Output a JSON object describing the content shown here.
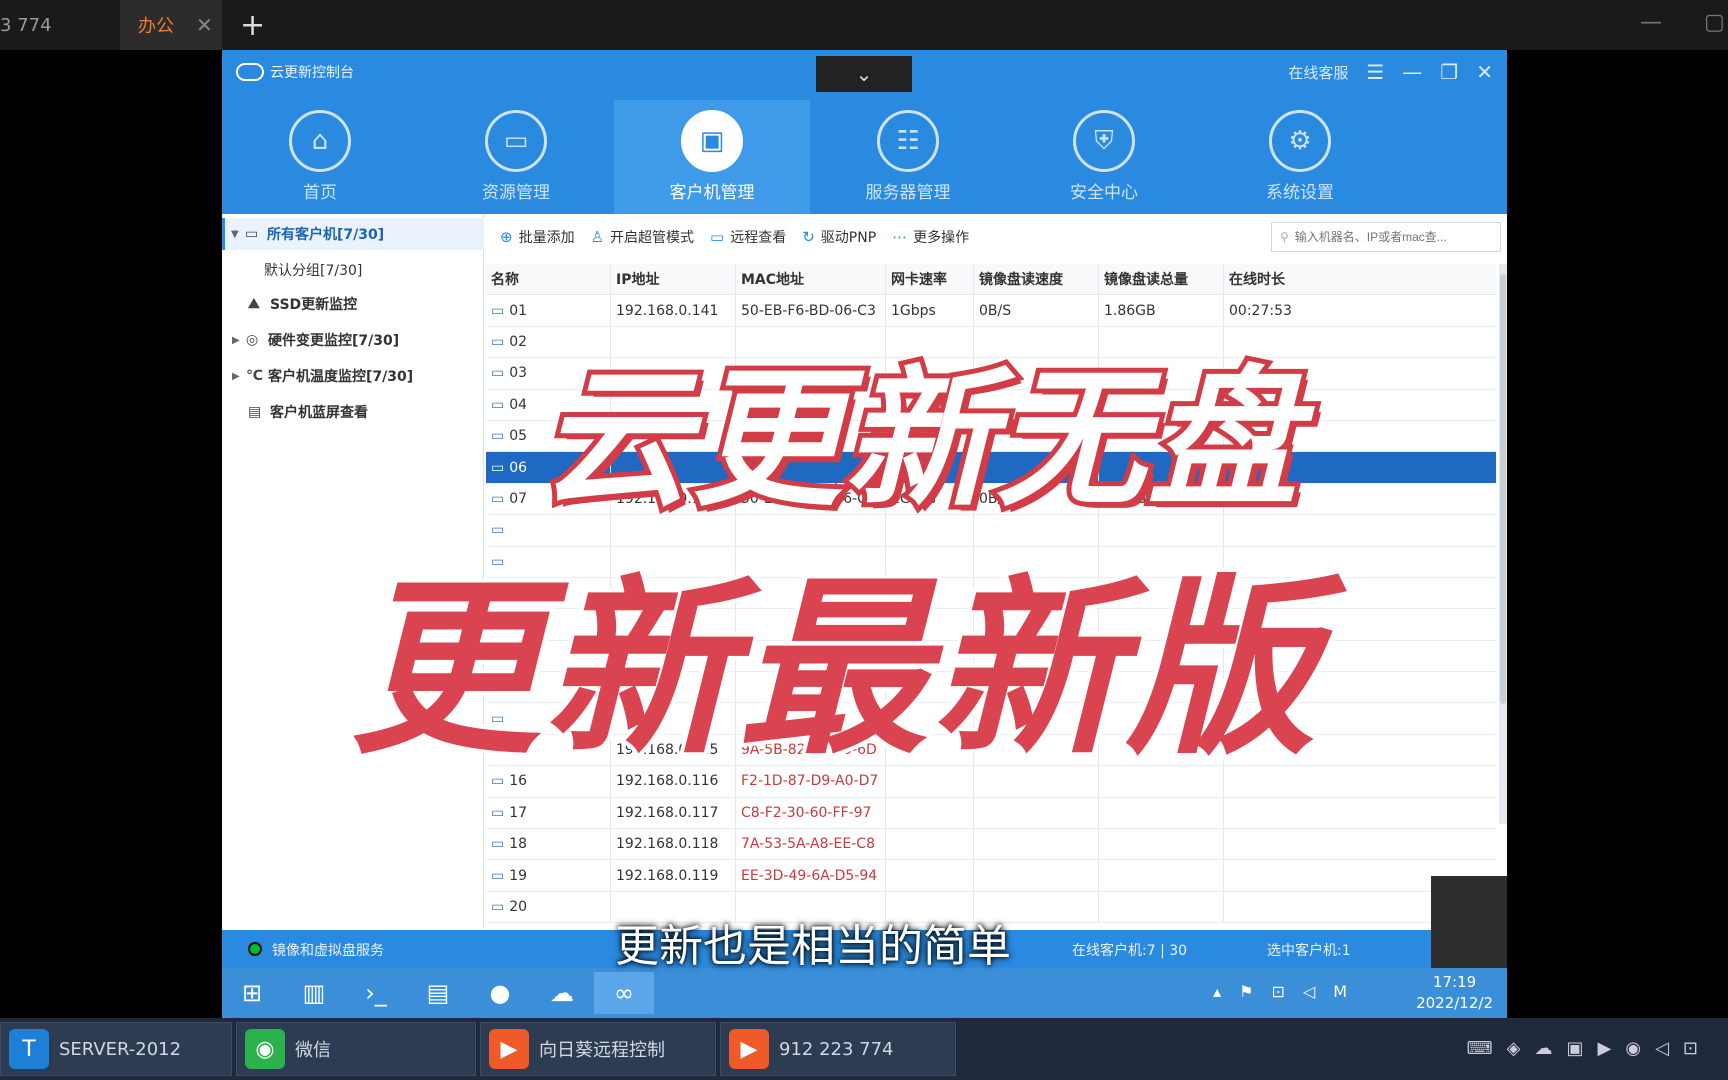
{
  "outer_tabs": {
    "tab1_label": "3 774",
    "tab2_label": "办公",
    "close_glyph": "✕",
    "new_tab_glyph": "+"
  },
  "app": {
    "title": "云更新控制台",
    "dropdown_glyph": "⌄",
    "online_service": "在线客服",
    "nav": [
      {
        "label": "首页",
        "icon": "home-icon"
      },
      {
        "label": "资源管理",
        "icon": "folder-icon"
      },
      {
        "label": "客户机管理",
        "icon": "monitor-icon"
      },
      {
        "label": "服务器管理",
        "icon": "server-icon"
      },
      {
        "label": "安全中心",
        "icon": "shield-icon"
      },
      {
        "label": "系统设置",
        "icon": "gear-icon"
      }
    ],
    "sidebar": [
      {
        "label": "所有客户机[7/30]"
      },
      {
        "label": "默认分组[7/30]"
      },
      {
        "label": "SSD更新监控"
      },
      {
        "label": "硬件变更监控[7/30]"
      },
      {
        "label": "客户机温度监控[7/30]"
      },
      {
        "label": "客户机蓝屏查看"
      }
    ],
    "toolbar": {
      "batch_add": "批量添加",
      "super_mode": "开启超管模式",
      "remote_view": "远程查看",
      "driver_pnp": "驱动PNP",
      "more": "更多操作",
      "search_placeholder": "输入机器名、IP或者mac查..."
    },
    "table": {
      "headers": [
        "名称",
        "IP地址",
        "MAC地址",
        "网卡速率",
        "镜像盘读速度",
        "镜像盘读总量",
        "在线时长"
      ],
      "rows": [
        {
          "name": "01",
          "ip": "192.168.0.141",
          "mac": "50-EB-F6-BD-06-C3",
          "speed": "1Gbps",
          "read_speed": "0B/S",
          "read_total": "1.86GB",
          "online": "00:27:53",
          "offline": false
        },
        {
          "name": "02",
          "ip": "",
          "mac": "",
          "speed": "",
          "read_speed": "",
          "read_total": "",
          "online": "",
          "offline": false
        },
        {
          "name": "03",
          "ip": "",
          "mac": "",
          "speed": "",
          "read_speed": "",
          "read_total": "",
          "online": "",
          "offline": false
        },
        {
          "name": "04",
          "ip": "",
          "mac": "",
          "speed": "",
          "read_speed": "",
          "read_total": "",
          "online": "",
          "offline": false
        },
        {
          "name": "05",
          "ip": "",
          "mac": "",
          "speed": "",
          "read_speed": "",
          "read_total": "",
          "online": "",
          "offline": false
        },
        {
          "name": "06",
          "ip": "",
          "mac": "",
          "speed": "",
          "read_speed": "",
          "read_total": "",
          "online": "",
          "offline": false
        },
        {
          "name": "07",
          "ip": "192.168.0.107",
          "mac": "50-EB-F6-BD-06-C8",
          "speed": "1Gbps",
          "read_speed": "0B/S",
          "read_total": "1.84GB",
          "online": "01:06:36",
          "offline": false
        },
        {
          "name": "",
          "ip": "",
          "mac": "",
          "speed": "",
          "read_speed": "",
          "read_total": "",
          "online": "",
          "offline": true
        },
        {
          "name": "",
          "ip": "",
          "mac": "",
          "speed": "",
          "read_speed": "",
          "read_total": "",
          "online": "",
          "offline": true
        },
        {
          "name": "",
          "ip": "",
          "mac": "",
          "speed": "",
          "read_speed": "",
          "read_total": "",
          "online": "",
          "offline": true
        },
        {
          "name": "",
          "ip": "",
          "mac": "",
          "speed": "",
          "read_speed": "",
          "read_total": "",
          "online": "",
          "offline": true
        },
        {
          "name": "",
          "ip": "",
          "mac": "",
          "speed": "",
          "read_speed": "",
          "read_total": "",
          "online": "",
          "offline": true
        },
        {
          "name": "",
          "ip": "",
          "mac": "",
          "speed": "",
          "read_speed": "",
          "read_total": "",
          "online": "",
          "offline": true
        },
        {
          "name": "",
          "ip": "",
          "mac": "",
          "speed": "",
          "read_speed": "",
          "read_total": "",
          "online": "",
          "offline": true
        },
        {
          "name": "15",
          "ip": "192.168.0.115",
          "mac": "9A-5B-82-A8-A0-6D",
          "speed": "",
          "read_speed": "",
          "read_total": "",
          "online": "",
          "offline": true
        },
        {
          "name": "16",
          "ip": "192.168.0.116",
          "mac": "F2-1D-87-D9-A0-D7",
          "speed": "",
          "read_speed": "",
          "read_total": "",
          "online": "",
          "offline": true
        },
        {
          "name": "17",
          "ip": "192.168.0.117",
          "mac": "C8-F2-30-60-FF-97",
          "speed": "",
          "read_speed": "",
          "read_total": "",
          "online": "",
          "offline": true
        },
        {
          "name": "18",
          "ip": "192.168.0.118",
          "mac": "7A-53-5A-A8-EE-C8",
          "speed": "",
          "read_speed": "",
          "read_total": "",
          "online": "",
          "offline": true
        },
        {
          "name": "19",
          "ip": "192.168.0.119",
          "mac": "EE-3D-49-6A-D5-94",
          "speed": "",
          "read_speed": "",
          "read_total": "",
          "online": "",
          "offline": true
        },
        {
          "name": "20",
          "ip": "",
          "mac": "",
          "speed": "",
          "read_speed": "",
          "read_total": "",
          "online": "",
          "offline": true
        }
      ],
      "selected_row": 5
    },
    "status": {
      "service": "镜像和虚拟盘服务",
      "clients": "在线客户机:7 | 30",
      "selected": "选中客户机:1"
    }
  },
  "inner_taskbar": {
    "time": "17:19",
    "date": "2022/12/2",
    "ime": "M"
  },
  "outer_taskbar": {
    "items": [
      {
        "label": "SERVER-2012",
        "color": "#1e7fd6"
      },
      {
        "label": "微信",
        "color": "#2bb24c"
      },
      {
        "label": "向日葵远程控制",
        "color": "#f05a28"
      },
      {
        "label": "912 223 774",
        "color": "#f05a28"
      }
    ]
  },
  "overlay": {
    "title_line1": "云更新无盘",
    "title_line2": "更新最新版",
    "subtitle": "更新也是相当的简单"
  },
  "colors": {
    "app_blue": "#2a8ae0",
    "selected_row": "#1f69c2",
    "overlay_red": "#d94450",
    "offline_mac_red": "#c93b3b"
  }
}
